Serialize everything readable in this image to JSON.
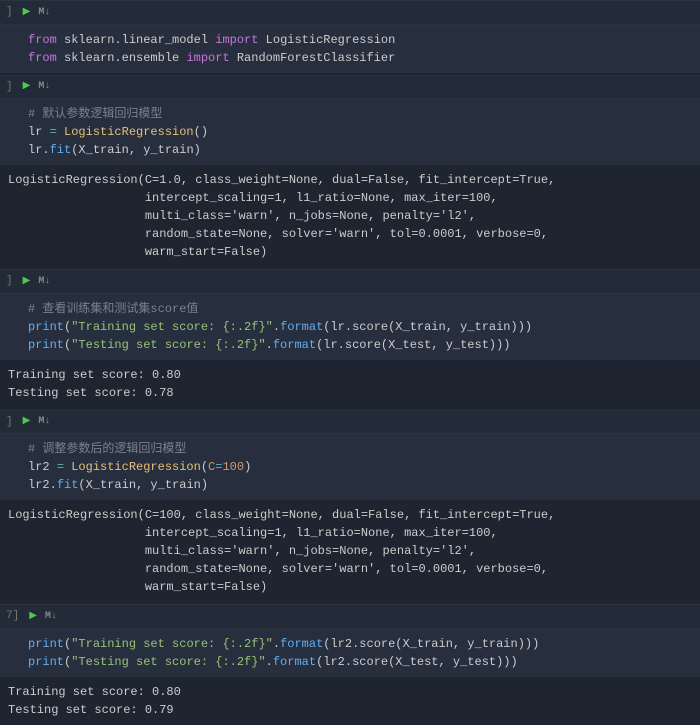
{
  "toolbar": {
    "bracket": "]",
    "bracket_num": "7]",
    "run_glyph": "▶",
    "md_label": "M↓"
  },
  "cell1": {
    "l1_from": "from",
    "l1_mod": " sklearn.linear_model ",
    "l1_import": "import",
    "l1_target": " LogisticRegression",
    "l2_from": "from",
    "l2_mod": " sklearn.ensemble ",
    "l2_import": "import",
    "l2_target": " RandomForestClassifier"
  },
  "cell2": {
    "c1": "# 默认参数逻辑回归模型",
    "l2a": "lr ",
    "l2b": "=",
    "l2c": " LogisticRegression",
    "l2d": "()",
    "l3a": "lr",
    "l3b": ".",
    "l3c": "fit",
    "l3d": "(X_train, y_train)"
  },
  "out2": "LogisticRegression(C=1.0, class_weight=None, dual=False, fit_intercept=True,\n                   intercept_scaling=1, l1_ratio=None, max_iter=100,\n                   multi_class='warn', n_jobs=None, penalty='l2',\n                   random_state=None, solver='warn', tol=0.0001, verbose=0,\n                   warm_start=False)",
  "cell3": {
    "c1": "# 查看训练集和测试集score值",
    "p1a": "print",
    "p1b": "(",
    "p1c": "\"Training set score: {:.2f}\"",
    "p1d": ".",
    "p1e": "format",
    "p1f": "(lr.score(X_train, y_train)))",
    "p2a": "print",
    "p2b": "(",
    "p2c": "\"Testing set score: {:.2f}\"",
    "p2d": ".",
    "p2e": "format",
    "p2f": "(lr.score(X_test, y_test)))"
  },
  "out3": "Training set score: 0.80\nTesting set score: 0.78",
  "cell4": {
    "c1": "# 调整参数后的逻辑回归模型",
    "l2a": "lr2 ",
    "l2b": "=",
    "l2c": " LogisticRegression",
    "l2d": "(",
    "l2e": "C",
    "l2f": "=",
    "l2g": "100",
    "l2h": ")",
    "l3a": "lr2",
    "l3b": ".",
    "l3c": "fit",
    "l3d": "(X_train, y_train)"
  },
  "out4": "LogisticRegression(C=100, class_weight=None, dual=False, fit_intercept=True,\n                   intercept_scaling=1, l1_ratio=None, max_iter=100,\n                   multi_class='warn', n_jobs=None, penalty='l2',\n                   random_state=None, solver='warn', tol=0.0001, verbose=0,\n                   warm_start=False)",
  "cell5": {
    "p1a": "print",
    "p1b": "(",
    "p1c": "\"Training set score: {:.2f}\"",
    "p1d": ".",
    "p1e": "format",
    "p1f": "(lr2.score(X_train, y_train)))",
    "p2a": "print",
    "p2b": "(",
    "p2c": "\"Testing set score: {:.2f}\"",
    "p2d": ".",
    "p2e": "format",
    "p2f": "(lr2.score(X_test, y_test)))"
  },
  "out5": "Training set score: 0.80\nTesting set score: 0.79"
}
